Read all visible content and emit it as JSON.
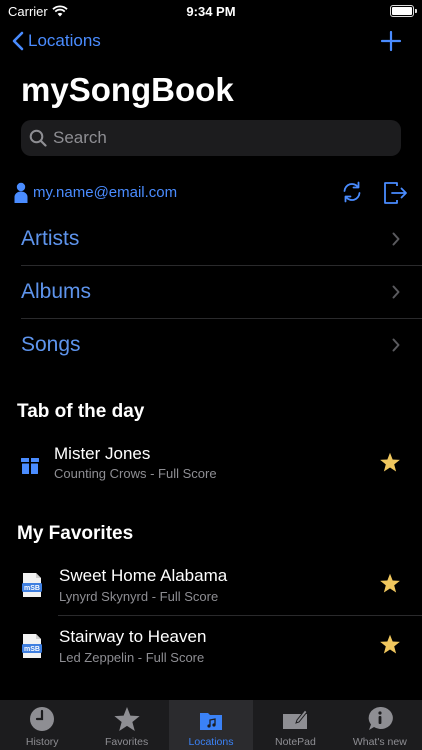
{
  "status_bar": {
    "carrier": "Carrier",
    "time": "9:34 PM"
  },
  "nav": {
    "back_label": "Locations"
  },
  "page_title": "mySongBook",
  "search": {
    "placeholder": "Search"
  },
  "account": {
    "email": "my.name@email.com"
  },
  "menu": [
    {
      "label": "Artists"
    },
    {
      "label": "Albums"
    },
    {
      "label": "Songs"
    }
  ],
  "tab_of_day": {
    "header": "Tab of the day",
    "title": "Mister Jones",
    "subtitle": "Counting Crows - Full Score"
  },
  "favorites": {
    "header": "My Favorites",
    "items": [
      {
        "title": "Sweet Home Alabama",
        "subtitle": "Lynyrd Skynyrd - Full Score",
        "icon_text": "mSB"
      },
      {
        "title": "Stairway to Heaven",
        "subtitle": "Led Zeppelin - Full Score",
        "icon_text": "mSB"
      }
    ]
  },
  "tab_bar": [
    {
      "label": "History",
      "icon": "clock-icon"
    },
    {
      "label": "Favorites",
      "icon": "star-icon"
    },
    {
      "label": "Locations",
      "icon": "folder-music-icon"
    },
    {
      "label": "NotePad",
      "icon": "notepad-icon"
    },
    {
      "label": "What's new",
      "icon": "info-bubble-icon"
    }
  ],
  "colors": {
    "accent": "#4a8cff",
    "star": "#f0c75e",
    "background": "#000000"
  }
}
